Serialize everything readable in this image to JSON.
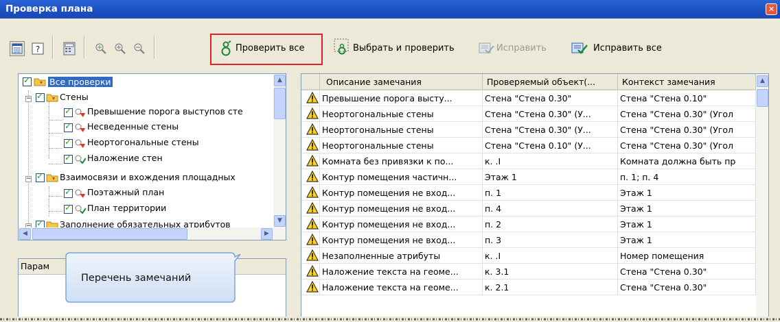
{
  "window": {
    "title": "Проверка плана",
    "close_icon": "close-icon"
  },
  "toolbar": {
    "check_all_label": "Проверить все",
    "select_check_label": "Выбрать и проверить",
    "fix_label": "Исправить",
    "fix_all_label": "Исправить все"
  },
  "tree": {
    "root": "Все проверки",
    "walls": "Стены",
    "wall_items": [
      "Превышение порога выступов сте",
      "Несведенные стены",
      "Неортогональные стены",
      "Наложение стен"
    ],
    "relations": "Взаимосвязи и вхождения площадных",
    "relation_items": [
      "Поэтажный план",
      "План территории"
    ],
    "attrs": "Заполнение обязательных атрибутов"
  },
  "params": {
    "header": "Парам"
  },
  "callout": {
    "text": "Перечень замечаний"
  },
  "table": {
    "columns": [
      "Описание замечания",
      "Проверяемый объект(...",
      "Контекст замечания"
    ],
    "rows": [
      [
        "Превышение порога высту...",
        "Стена \"Стена 0.30\"",
        "Стена \"Стена 0.10\""
      ],
      [
        "Неортогональные стены",
        "Стена \"Стена 0.30\" (У...",
        "Стена \"Стена 0.30\" (Угол"
      ],
      [
        "Неортогональные стены",
        "Стена \"Стена 0.30\" (У...",
        "Стена \"Стена 0.30\" (Угол"
      ],
      [
        "Неортогональные стены",
        "Стена \"Стена 0.10\" (У...",
        "Стена \"Стена 0.30\" (Угол"
      ],
      [
        "Комната без привязки к по...",
        "к. .I",
        "Комната должна быть пр"
      ],
      [
        "Контур помещения частичн...",
        "Этаж 1",
        "п. 1; п. 4"
      ],
      [
        "Контур помещения не вход...",
        "п. 1",
        "Этаж 1"
      ],
      [
        "Контур помещения не вход...",
        "п. 4",
        "Этаж 1"
      ],
      [
        "Контур помещения не вход...",
        "п. 2",
        "Этаж 1"
      ],
      [
        "Контур помещения не вход...",
        "п. 3",
        "Этаж 1"
      ],
      [
        "Незаполненные атрибуты",
        "к. .I",
        "Номер помещения"
      ],
      [
        "Наложение текста на геоме...",
        "к. 3.1",
        "Стена \"Стена 0.30\""
      ],
      [
        "Наложение текста на геоме...",
        "к. 2.1",
        "Стена \"Стена 0.30\""
      ]
    ]
  },
  "colors": {
    "highlight": "#e0202a",
    "titlebar": "#1a4fc0",
    "selection": "#316ac5"
  }
}
